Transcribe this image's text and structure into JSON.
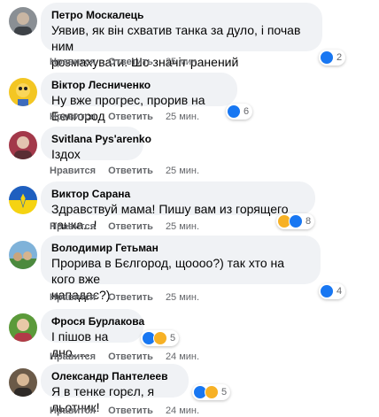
{
  "labels": {
    "like": "Нравится",
    "reply": "Ответить"
  },
  "colors": {
    "like_blue": "#1877f2",
    "haha_yellow": "#f7b125",
    "bubble_bg": "#f0f2f5",
    "meta_gray": "#65676b"
  },
  "comments": [
    {
      "author": "Петро Москалець",
      "text": "Уявив, як він схватив танка за дуло, і почав ним\nрозмахувати. Шо значіт ранений",
      "time": "25 мин.",
      "reactions": [
        "like"
      ],
      "count": "2"
    },
    {
      "author": "Віктор Лесниченко",
      "text": "Ну вже прогрес, прорив на Белгород",
      "time": "25 мин.",
      "reactions": [
        "like"
      ],
      "count": "6"
    },
    {
      "author": "Svitlana Pys'arenko",
      "text": "Іздох",
      "time": "25 мин.",
      "reactions": [],
      "count": ""
    },
    {
      "author": "Виктор Сарана",
      "text": "Здравствуй мама! Пишу вам из горящего танка...!",
      "time": "25 мин.",
      "reactions": [
        "haha",
        "like"
      ],
      "count": "8"
    },
    {
      "author": "Володимир Гетьман",
      "text": "Прорива в Бєлгород, щоооо?) так хто на кого вже\nнападає?)",
      "time": "25 мин.",
      "reactions": [
        "like"
      ],
      "count": "4"
    },
    {
      "author": "Фрося Бурлакова",
      "text": "І пішов на дно.....",
      "time": "24 мин.",
      "reactions": [
        "like",
        "haha"
      ],
      "count": "5"
    },
    {
      "author": "Олександр Пантелеев",
      "text": "Я в тенке горєл, я льотчик!",
      "time": "24 мин.",
      "reactions": [
        "like",
        "haha"
      ],
      "count": "5"
    }
  ]
}
